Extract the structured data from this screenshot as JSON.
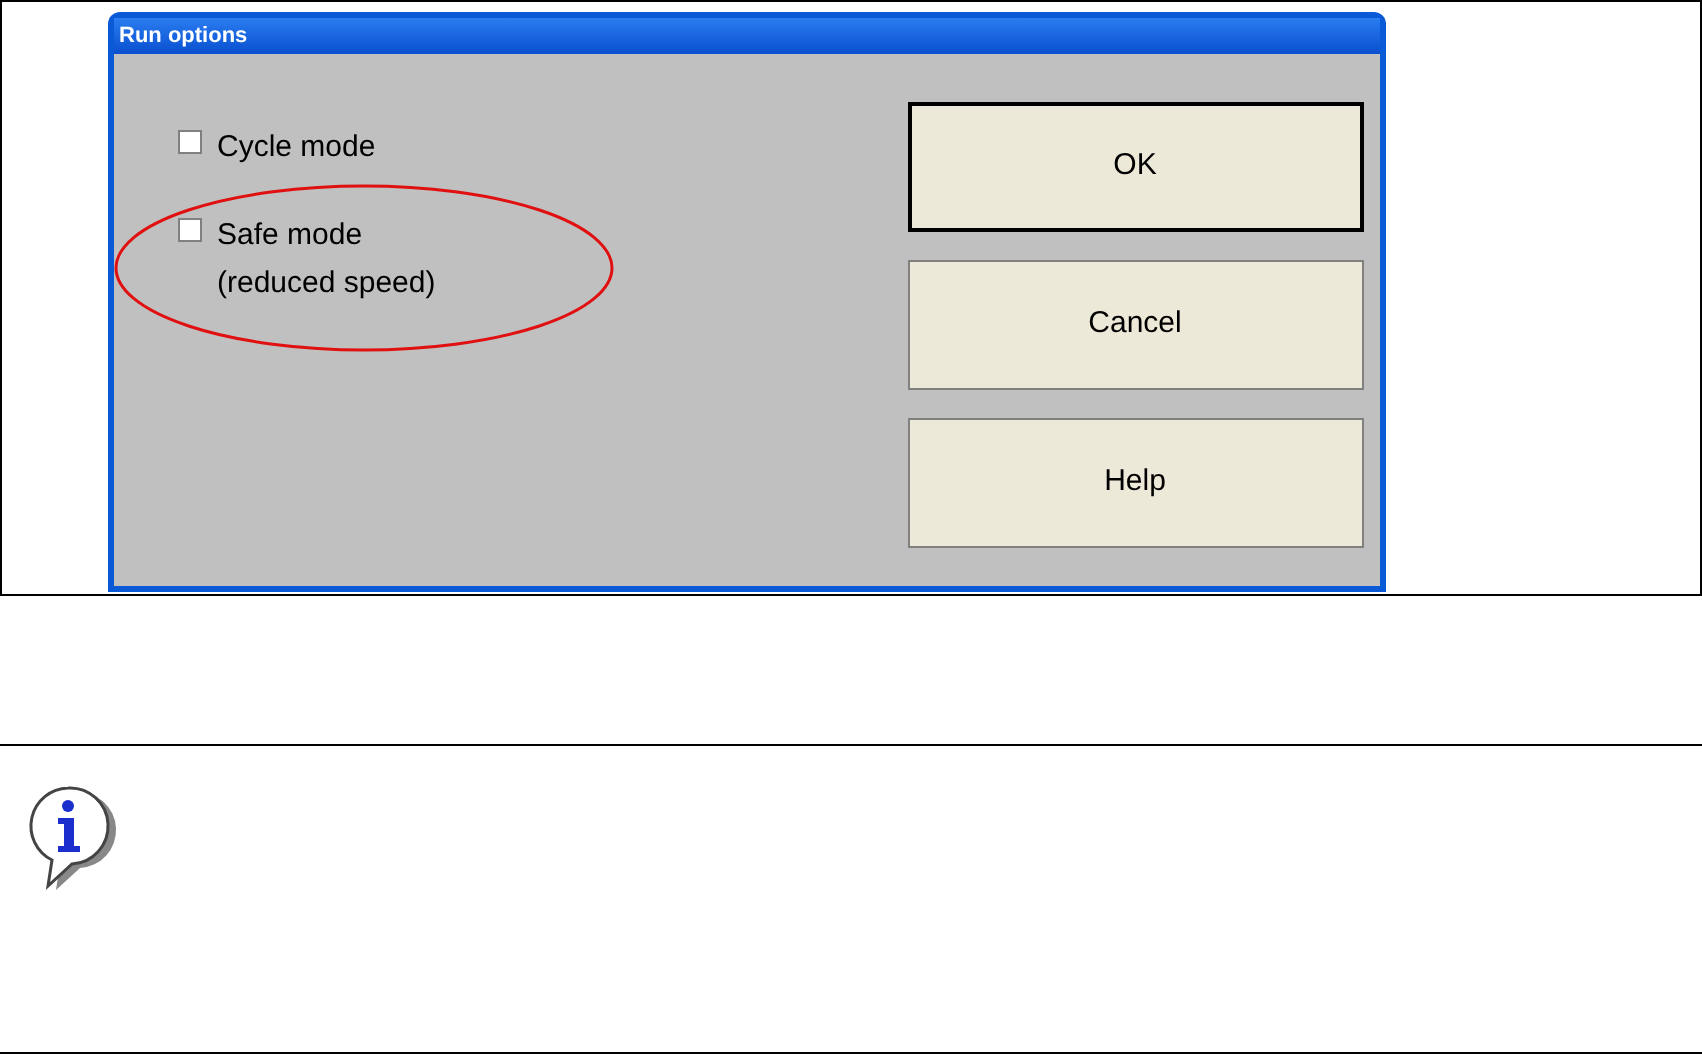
{
  "dialog": {
    "title": "Run options",
    "options": [
      {
        "label": "Cycle mode",
        "checked": false
      },
      {
        "label": "Safe mode\n(reduced speed)",
        "checked": false,
        "highlighted": true
      }
    ],
    "buttons": [
      {
        "label": "OK",
        "default": true
      },
      {
        "label": "Cancel",
        "default": false
      },
      {
        "label": "Help",
        "default": false
      }
    ]
  }
}
